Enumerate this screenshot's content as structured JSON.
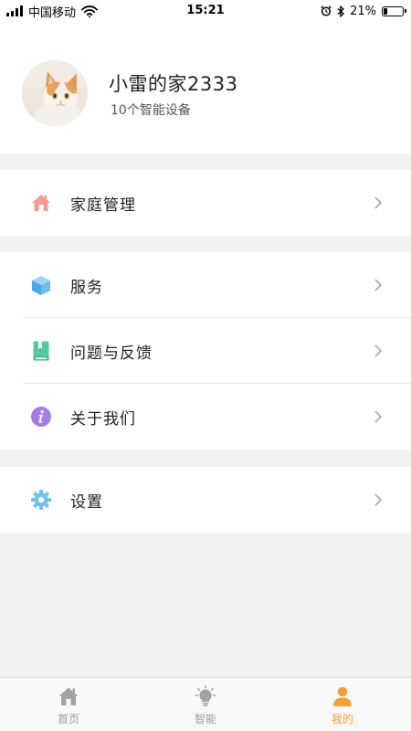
{
  "status_bar": {
    "carrier": "中国移动",
    "time": "15:21",
    "battery_text": "21%",
    "battery_level": 0.21,
    "icons": [
      "signal-icon",
      "wifi-icon",
      "alarm-icon",
      "bluetooth-icon",
      "battery-icon"
    ]
  },
  "profile": {
    "avatar": "cat-avatar",
    "name": "小雷的家2333",
    "subtitle": "10个智能设备"
  },
  "menu": {
    "home_management": {
      "label": "家庭管理",
      "icon": "home-icon",
      "color": "#f29a91"
    },
    "service": {
      "label": "服务",
      "icon": "cube-icon",
      "color": "#5aaee6"
    },
    "feedback": {
      "label": "问题与反馈",
      "icon": "book-icon",
      "color": "#52c9a0"
    },
    "about": {
      "label": "关于我们",
      "icon": "info-icon",
      "color": "#a57be8"
    },
    "settings": {
      "label": "设置",
      "icon": "gear-icon",
      "color": "#6ec3ee"
    }
  },
  "tab_bar": {
    "tabs": [
      {
        "label": "首页",
        "icon": "home-tab-icon",
        "active": false
      },
      {
        "label": "智能",
        "icon": "bulb-tab-icon",
        "active": false
      },
      {
        "label": "我的",
        "icon": "user-tab-icon",
        "active": true
      }
    ],
    "active_color": "#f5a036",
    "inactive_color": "#9b9b9b"
  }
}
